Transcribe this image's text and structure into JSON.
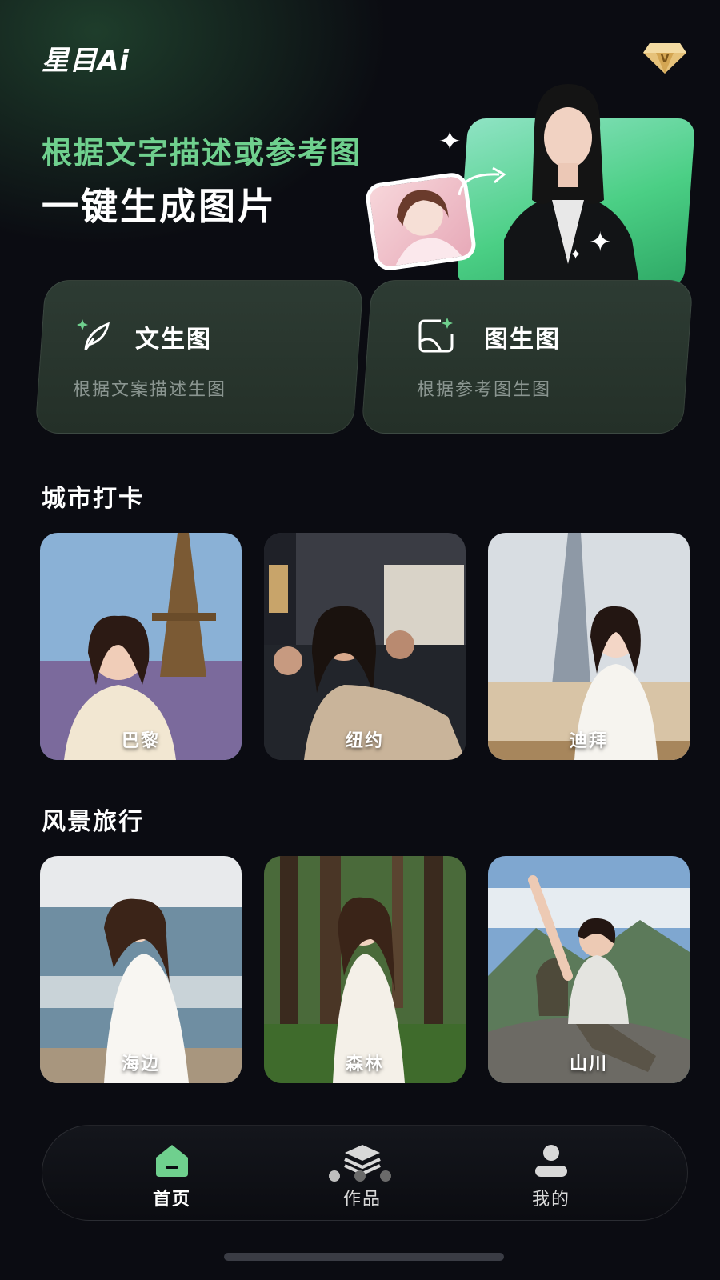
{
  "header": {
    "logo_text": "星目Ai",
    "vip_icon": "vip-diamond-icon"
  },
  "hero": {
    "line1": "根据文字描述或参考图",
    "line2": "一键生成图片"
  },
  "features": [
    {
      "title": "文生图",
      "subtitle": "根据文案描述生图",
      "icon": "quill-sparkle-icon"
    },
    {
      "title": "图生图",
      "subtitle": "根据参考图生图",
      "icon": "image-sparkle-icon"
    }
  ],
  "sections": [
    {
      "title": "城市打卡",
      "items": [
        {
          "label": "巴黎"
        },
        {
          "label": "纽约"
        },
        {
          "label": "迪拜"
        }
      ]
    },
    {
      "title": "风景旅行",
      "items": [
        {
          "label": "海边"
        },
        {
          "label": "森林"
        },
        {
          "label": "山川"
        }
      ]
    }
  ],
  "nav": {
    "items": [
      {
        "label": "首页",
        "icon": "home-icon",
        "active": true
      },
      {
        "label": "作品",
        "icon": "layers-icon",
        "active": false
      },
      {
        "label": "我的",
        "icon": "user-icon",
        "active": false
      }
    ]
  },
  "colors": {
    "accent": "#6fd08e",
    "background": "#0b0c12",
    "card": "#2a3830"
  }
}
